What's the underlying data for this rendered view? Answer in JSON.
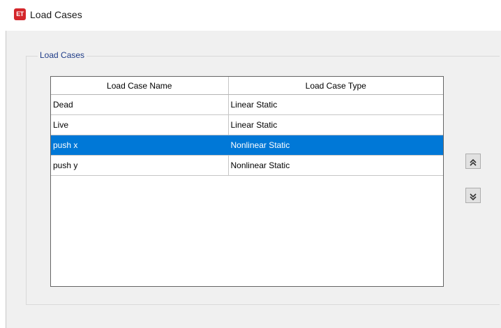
{
  "window": {
    "icon_text": "ET",
    "title": "Load Cases"
  },
  "group": {
    "label": "Load Cases"
  },
  "table": {
    "columns": [
      "Load Case Name",
      "Load Case Type"
    ],
    "rows": [
      {
        "name": "Dead",
        "type": "Linear Static"
      },
      {
        "name": "Live",
        "type": "Linear Static"
      },
      {
        "name": "push x",
        "type": "Nonlinear Static"
      },
      {
        "name": "push y",
        "type": "Nonlinear Static"
      }
    ],
    "selected_row": 2
  },
  "buttons": {
    "move_up_icon": "double-chevron-up-icon",
    "move_down_icon": "double-chevron-down-icon"
  },
  "colors": {
    "selection": "#0078d7",
    "legend_text": "#1f3c88",
    "app_icon": "#d4262b"
  }
}
